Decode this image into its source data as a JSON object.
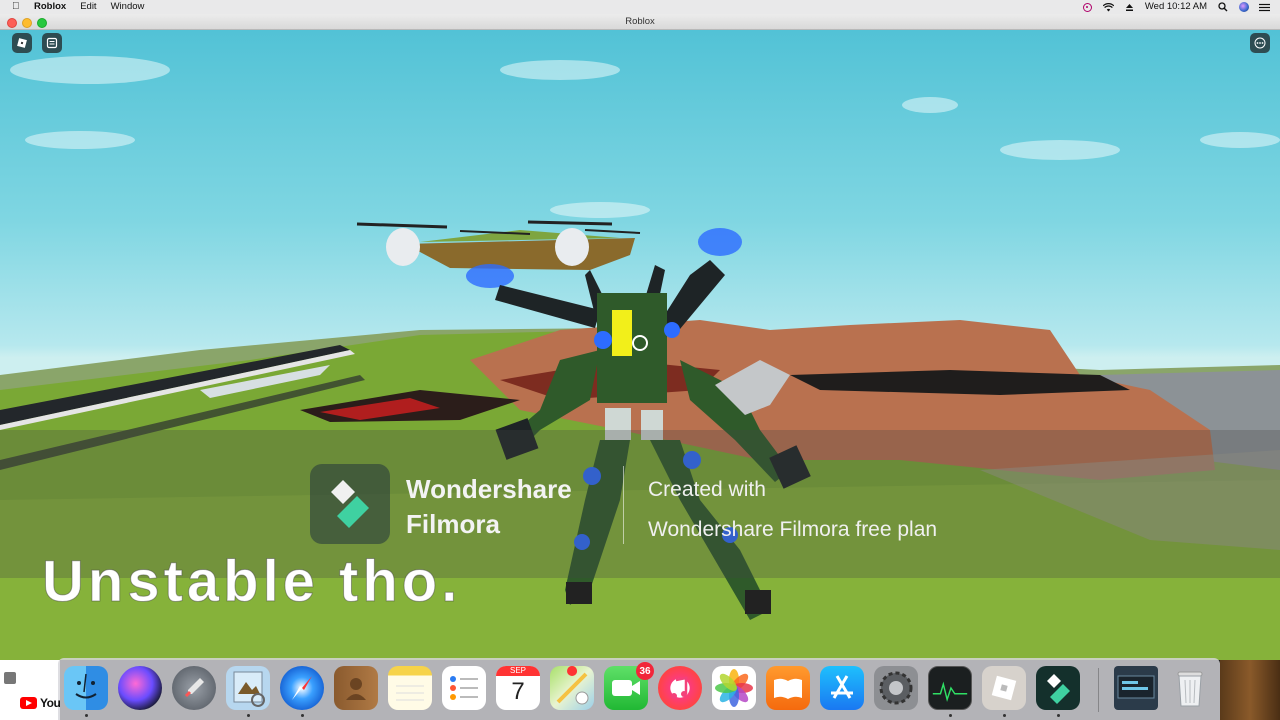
{
  "menubar": {
    "app_name": "Roblox",
    "menus": [
      "Edit",
      "Window"
    ],
    "clock": "Wed 10:12 AM",
    "icons": [
      "apple-icon",
      "screen-record-icon",
      "wifi-icon",
      "eject-icon",
      "spotlight-search-icon",
      "siri-icon",
      "control-icon"
    ]
  },
  "window": {
    "title": "Roblox"
  },
  "game": {
    "caption": "Unstable tho.",
    "roblox_menu_icon": "roblox-logo-icon",
    "chat_icon": "chat-icon",
    "more_icon": "more-options-icon"
  },
  "watermark": {
    "brand_line1": "Wondershare",
    "brand_line2": "Filmora",
    "created_line1": "Created with",
    "created_line2": "Wondershare Filmora free plan"
  },
  "desktop": {
    "youtube_text": "You"
  },
  "dock": {
    "items": [
      {
        "name": "finder",
        "icon": "finder-icon",
        "running": true
      },
      {
        "name": "siri",
        "icon": "siri-icon",
        "running": false
      },
      {
        "name": "launchpad",
        "icon": "launchpad-icon",
        "running": false
      },
      {
        "name": "preview",
        "icon": "preview-icon",
        "running": true
      },
      {
        "name": "safari",
        "icon": "safari-icon",
        "running": true
      },
      {
        "name": "contacts",
        "icon": "contacts-icon",
        "running": false
      },
      {
        "name": "notes",
        "icon": "notes-icon",
        "running": false
      },
      {
        "name": "reminders",
        "icon": "reminders-icon",
        "running": false
      },
      {
        "name": "calendar",
        "icon": "calendar-icon",
        "running": false,
        "month": "SEP",
        "day": "7"
      },
      {
        "name": "maps",
        "icon": "maps-icon",
        "running": false
      },
      {
        "name": "facetime",
        "icon": "facetime-icon",
        "running": false,
        "badge": "36"
      },
      {
        "name": "music",
        "icon": "music-icon",
        "running": false
      },
      {
        "name": "photos",
        "icon": "photos-icon",
        "running": false
      },
      {
        "name": "books",
        "icon": "books-icon",
        "running": false
      },
      {
        "name": "app-store",
        "icon": "app-store-icon",
        "running": false
      },
      {
        "name": "system-preferences",
        "icon": "gear-icon",
        "running": false
      },
      {
        "name": "activity-monitor",
        "icon": "activity-monitor-icon",
        "running": true
      },
      {
        "name": "roblox",
        "icon": "roblox-icon",
        "running": true
      },
      {
        "name": "filmora",
        "icon": "filmora-icon",
        "running": true
      },
      {
        "name": "screen-recording",
        "icon": "screen-recording-icon",
        "running": false
      },
      {
        "name": "trash",
        "icon": "trash-icon",
        "running": false
      }
    ]
  },
  "colors": {
    "sky_top": "#52c2d6",
    "grass": "#7aa835",
    "mesa": "#b9714f",
    "mech_green": "#2f5a2a",
    "thruster_blue": "#2d6cff",
    "filmora_teal": "#3fd1a1"
  }
}
